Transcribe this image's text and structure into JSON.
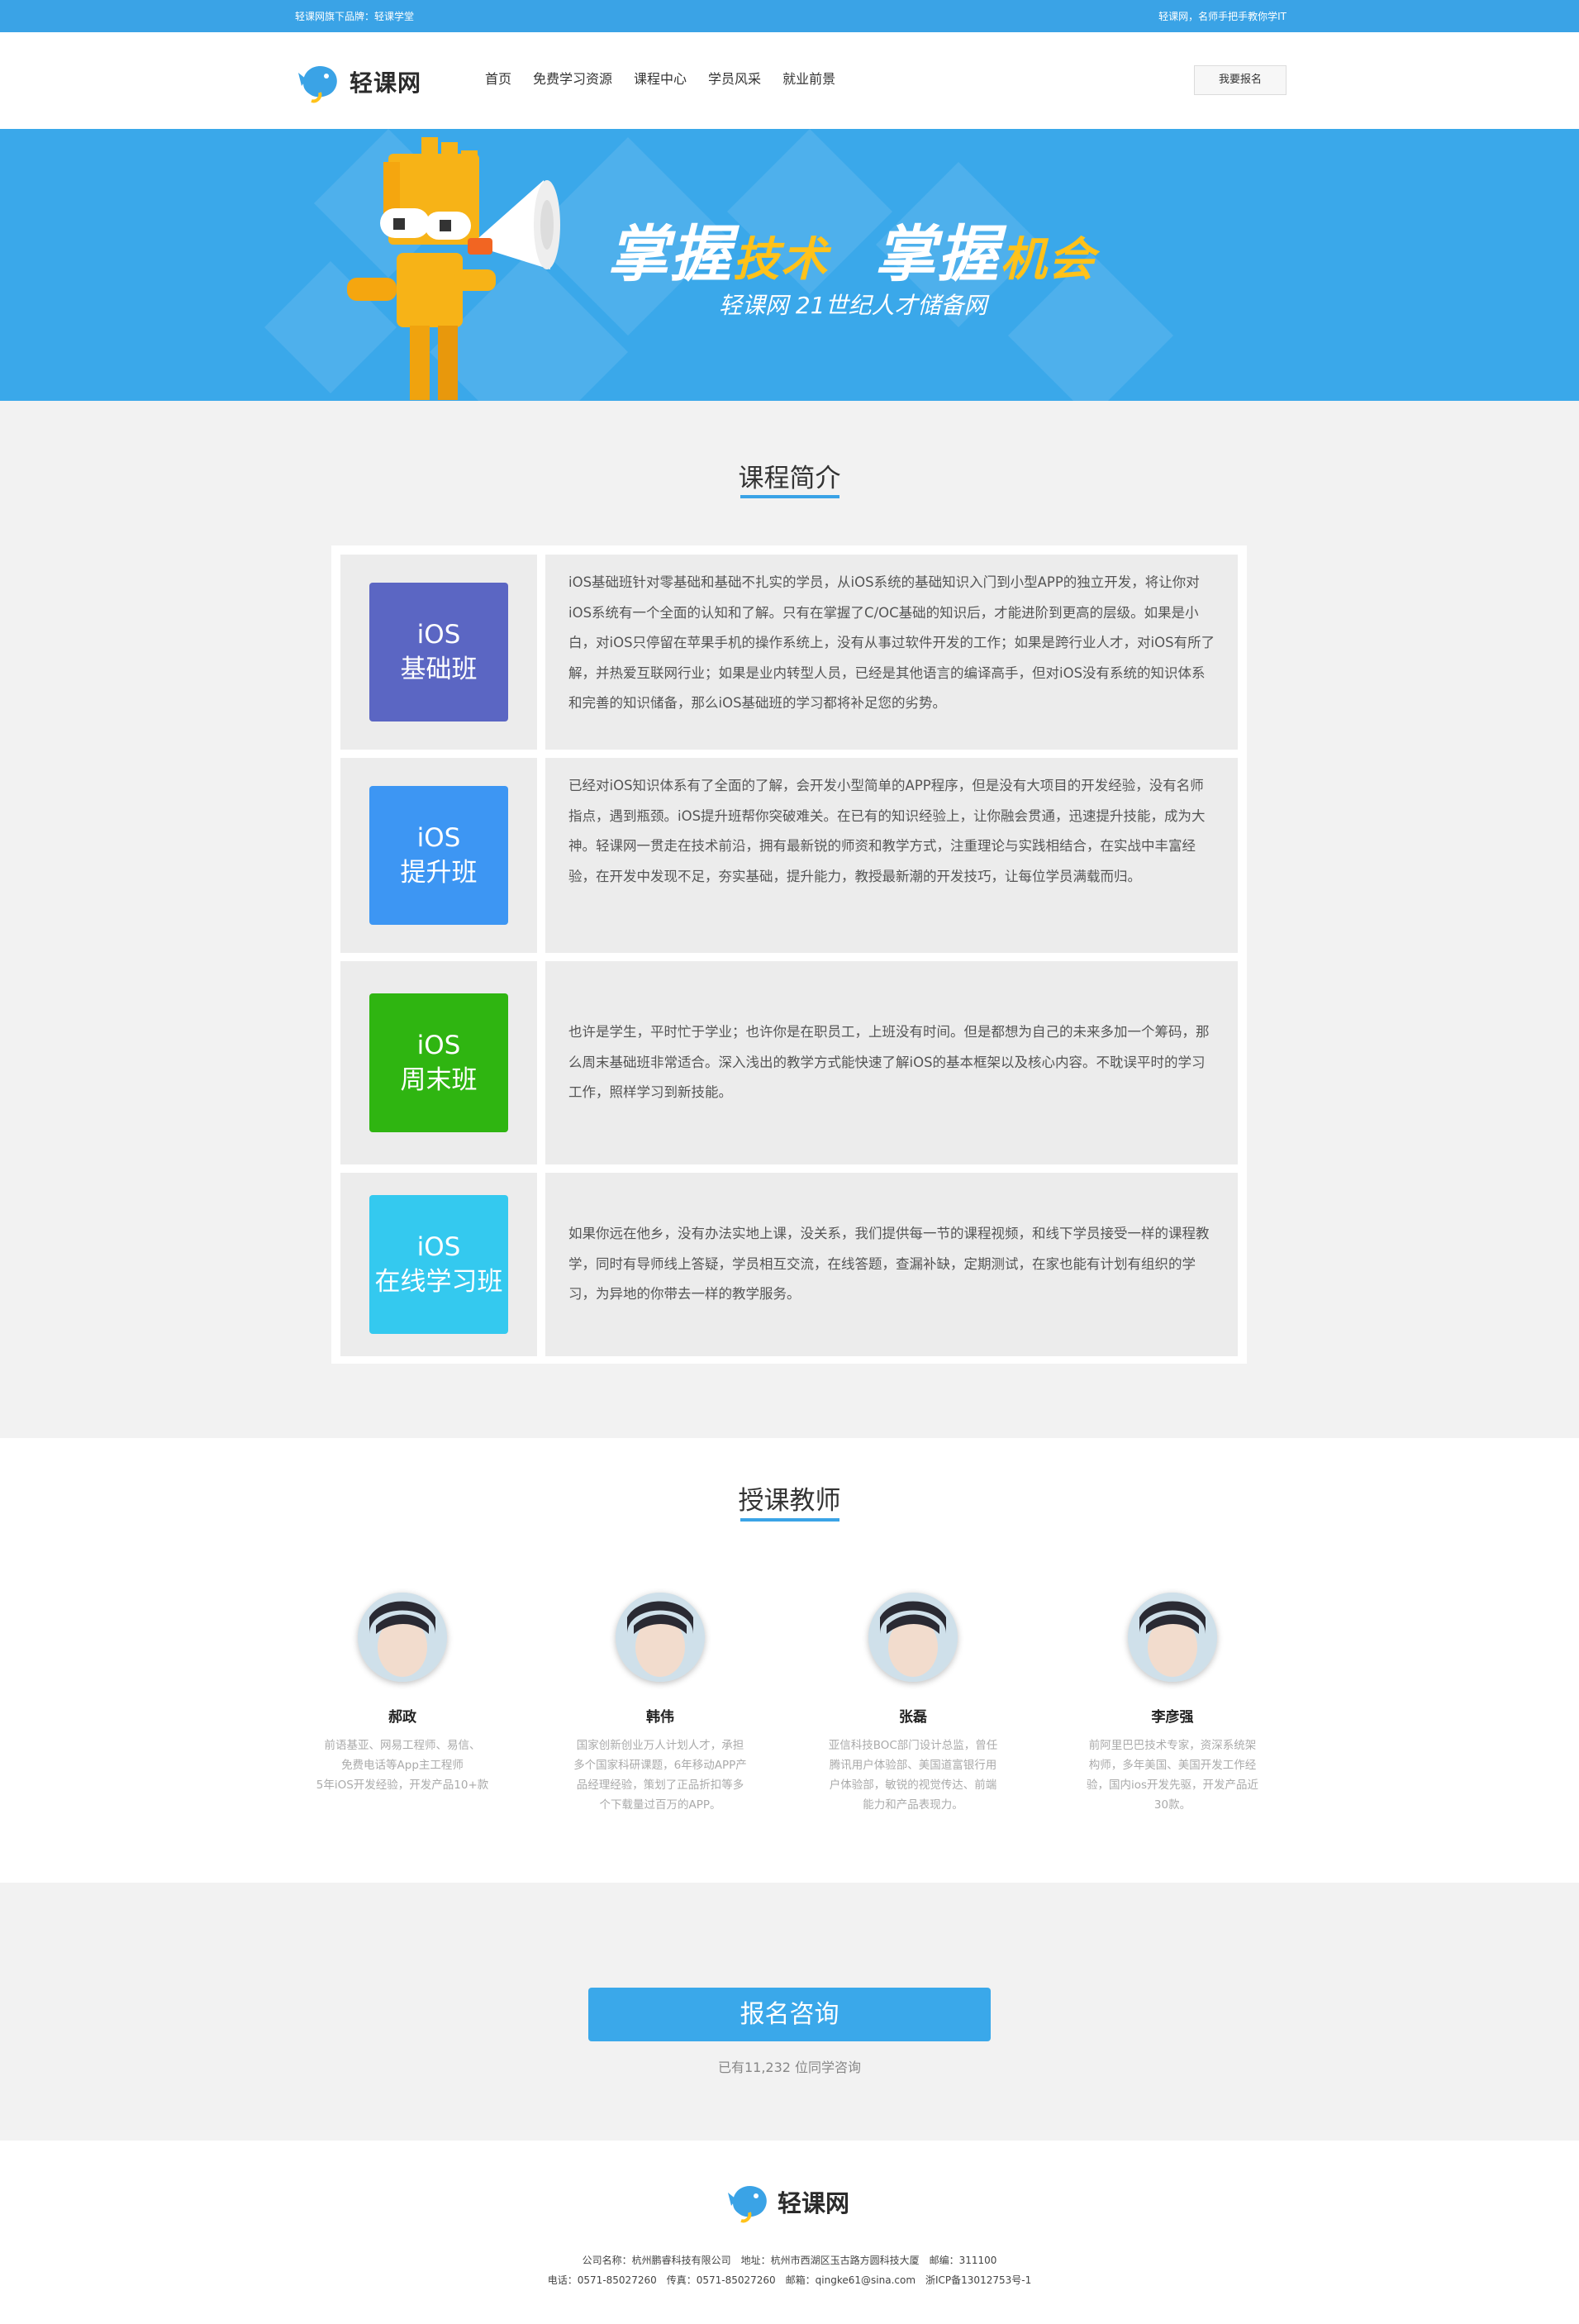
{
  "topbar": {
    "left_text": "轻课网旗下品牌：轻课学堂",
    "right_text": "轻课网，名师手把手教你学IT"
  },
  "header": {
    "logo_text": "轻课网",
    "nav": [
      "首页",
      "免费学习资源",
      "课程中心",
      "学员风采",
      "就业前景"
    ],
    "enroll_button": "我要报名"
  },
  "banner": {
    "slogan_parts": [
      "掌握",
      "技术",
      "掌握",
      "机会"
    ],
    "subtitle": "轻课网 21世纪人才储备网"
  },
  "intro": {
    "title": "课程简介",
    "courses": [
      {
        "line1": "iOS",
        "line2": "基础班",
        "color": "#5b66c3",
        "desc": "iOS基础班针对零基础和基础不扎实的学员，从iOS系统的基础知识入门到小型APP的独立开发，将让你对iOS系统有一个全面的认知和了解。只有在掌握了C/OC基础的知识后，才能进阶到更高的层级。如果是小白，对iOS只停留在苹果手机的操作系统上，没有从事过软件开发的工作；如果是跨行业人才，对iOS有所了解，并热爱互联网行业；如果是业内转型人员，已经是其他语言的编译高手，但对iOS没有系统的知识体系和完善的知识储备，那么iOS基础班的学习都将补足您的劣势。"
      },
      {
        "line1": "iOS",
        "line2": "提升班",
        "color": "#3d96f3",
        "desc": "已经对iOS知识体系有了全面的了解，会开发小型简单的APP程序，但是没有大项目的开发经验，没有名师指点，遇到瓶颈。iOS提升班帮你突破难关。在已有的知识经验上，让你融会贯通，迅速提升技能，成为大神。轻课网一贯走在技术前沿，拥有最新锐的师资和教学方式，注重理论与实践相结合，在实战中丰富经验，在开发中发现不足，夯实基础，提升能力，教授最新潮的开发技巧，让每位学员满载而归。"
      },
      {
        "line1": "iOS",
        "line2": "周末班",
        "color": "#2fb511",
        "desc": "也许是学生，平时忙于学业；也许你是在职员工，上班没有时间。但是都想为自己的未来多加一个筹码，那么周末基础班非常适合。深入浅出的教学方式能快速了解iOS的基本框架以及核心内容。不耽误平时的学习工作，照样学习到新技能。"
      },
      {
        "line1": "iOS",
        "line2": "在线学习班",
        "color": "#34c9ef",
        "desc": "如果你远在他乡，没有办法实地上课，没关系，我们提供每一节的课程视频，和线下学员接受一样的课程教学，同时有导师线上答疑，学员相互交流，在线答题，查漏补缺，定期测试，在家也能有计划有组织的学习，为异地的你带去一样的教学服务。"
      }
    ]
  },
  "teachers": {
    "title": "授课教师",
    "list": [
      {
        "name": "郝政",
        "desc": [
          "前语基亚、网易工程师、易信、",
          "免费电话等App主工程师",
          "5年iOS开发经验，开发产品10+款"
        ]
      },
      {
        "name": "韩伟",
        "desc": [
          "国家创新创业万人计划人才，承担",
          "多个国家科研课题，6年移动APP产",
          "品经理经验，策划了正品折扣等多",
          "个下载量过百万的APP。"
        ]
      },
      {
        "name": "张磊",
        "desc": [
          "亚信科技BOC部门设计总监，曾任",
          "腾讯用户体验部、美国道富银行用",
          "户体验部，敏锐的视觉传达、前端",
          "能力和产品表现力。"
        ]
      },
      {
        "name": "李彦强",
        "desc": [
          "前阿里巴巴技术专家，资深系统架",
          "构师，多年美国、美国开发工作经",
          "验，国内ios开发先驱，开发产品近",
          "30款。"
        ]
      }
    ]
  },
  "cta": {
    "button": "报名咨询",
    "note": "已有11,232 位同学咨询"
  },
  "footer": {
    "logo_text": "轻课网",
    "line1": "公司名称：杭州鹏睿科技有限公司　地址：杭州市西湖区玉古路方圆科技大厦　邮编：311100",
    "line2": "电话：0571-85027260　传真：0571-85027260　邮箱：qingke61@sina.com　浙ICP备13012753号-1"
  },
  "colors": {
    "primary": "#3aa3e6",
    "banner": "#3aa8ea",
    "accent_yellow": "#ffc21a",
    "section_bg": "#f2f2f2"
  }
}
